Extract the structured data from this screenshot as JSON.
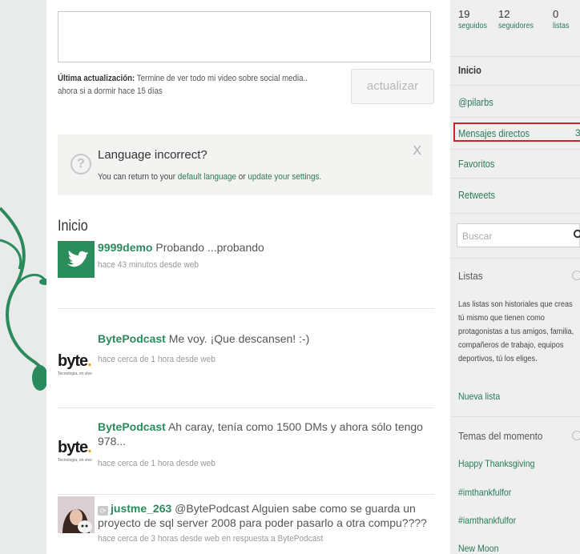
{
  "status": {
    "last_update_label": "Última actualización:",
    "last_update_text": "Termine de ver todo mi video sobre social media.. ahora si a dormir",
    "last_update_time": "hace 15 días",
    "update_button": "actualizar"
  },
  "language_notice": {
    "title": "Language incorrect?",
    "text_before": "You can return to your ",
    "link_default": "default language",
    "text_mid": " or ",
    "link_settings": "update your settings",
    "text_after": ".",
    "close": "X"
  },
  "feed": {
    "title": "Inicio",
    "tweets": [
      {
        "user": "9999demo",
        "text": "Probando ...probando",
        "meta": "hace 43 minutos desde web"
      },
      {
        "user": "BytePodcast",
        "text": "Me voy. ¡Que descansen! :-)",
        "meta": "hace cerca de 1 hora desde web"
      },
      {
        "user": "BytePodcast",
        "text": "Ah caray, tenía como 1500 DMs y ahora sólo tengo 978...",
        "meta": "hace cerca de 1 hora desde web"
      },
      {
        "user": "justme_263",
        "text": "@BytePodcast Alguien sabe como se guarda un proyecto de sql server 2008 para poder pasarlo a otra compu????",
        "meta": "hace cerca de 3 horas desde web en respuesta a BytePodcast"
      }
    ]
  },
  "byte_logo": {
    "word": "byte",
    "dot": ".",
    "tagline": "Tecnología, en vivo"
  },
  "sidebar": {
    "stats": [
      {
        "num": "19",
        "label": "seguidos"
      },
      {
        "num": "12",
        "label": "seguidores"
      },
      {
        "num": "0",
        "label": "listas"
      }
    ],
    "nav": [
      "Inicio",
      "@pilarbs",
      "Mensajes directos",
      "Favoritos",
      "Retweets"
    ],
    "dm_count": "3",
    "search_placeholder": "Buscar",
    "lists_heading": "Listas",
    "lists_description": "Las listas son historiales que creas tú mismo que tienen como protagonistas a tus amigos, familia, compañeros de trabajo, equipos deportivos, tú los eliges.",
    "new_list": "Nueva lista",
    "trends_heading": "Temas del momento",
    "trends": [
      "Happy Thanksgiving",
      "#imthankfulfor",
      "#iamthankfulfor",
      "New Moon"
    ]
  },
  "colors": {
    "link_green": "#2a7a56",
    "highlight_red": "#d0202c",
    "sidebar_bg": "#efefef"
  }
}
